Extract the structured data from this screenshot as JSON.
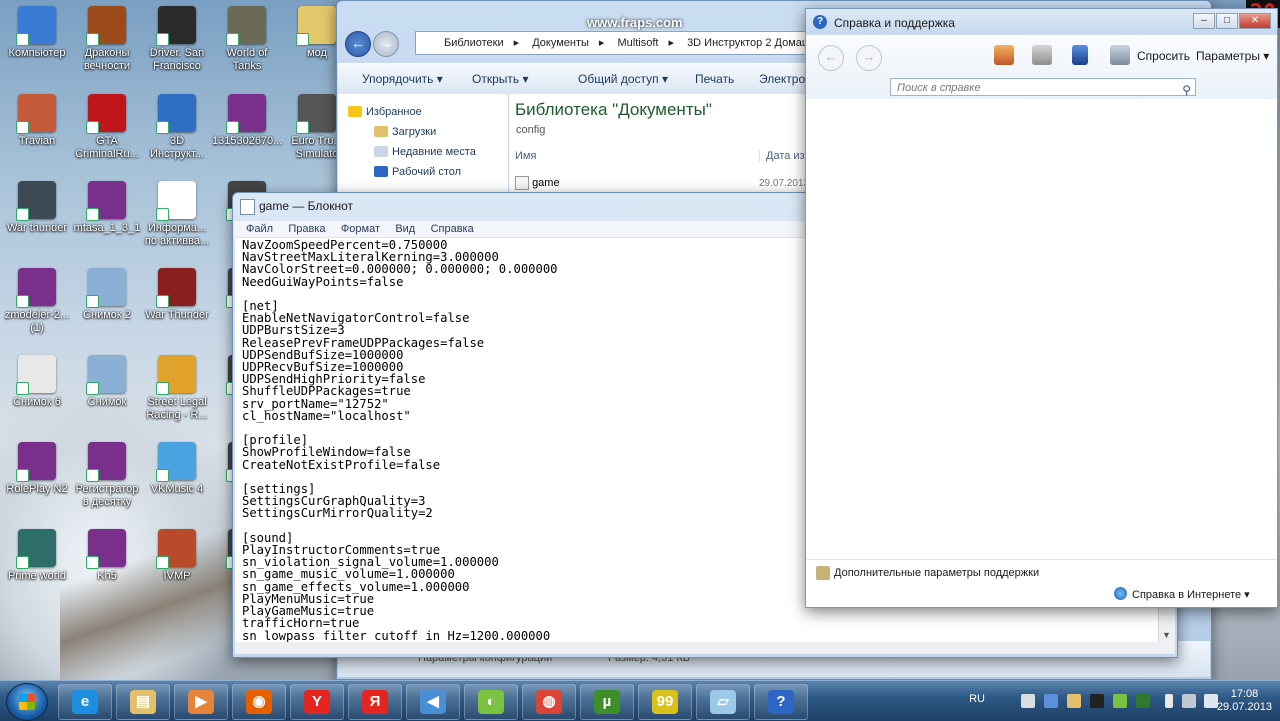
{
  "desktop": {
    "icons": [
      {
        "label": "Компьютер",
        "color": "#3a7bd5"
      },
      {
        "label": "Драконы вечности",
        "color": "#9c4a1a"
      },
      {
        "label": "Driver. San Francisco",
        "color": "#2b2b2b"
      },
      {
        "label": "World of Tanks",
        "color": "#6b6b55"
      },
      {
        "label": "мод",
        "color": "#e5c76b"
      },
      {
        "label": "Travian",
        "color": "#c45a3a"
      },
      {
        "label": "GTA CriminalRu...",
        "color": "#c0161b"
      },
      {
        "label": "3D Инструкт...",
        "color": "#2f6fc2"
      },
      {
        "label": "1315302670...",
        "color": "#7a2f8c"
      },
      {
        "label": "Euro Tru... Simulato",
        "color": "#555555"
      },
      {
        "label": "War thunder",
        "color": "#3d4a55"
      },
      {
        "label": "mtasa_1_3_1",
        "color": "#7a2f8c"
      },
      {
        "label": "Информа... по активва...",
        "color": "#ffffff"
      },
      {
        "label": "La",
        "color": "#444444"
      },
      {
        "label": "zmodeler-2... (1)",
        "color": "#7a2f8c"
      },
      {
        "label": "Снимок 2",
        "color": "#8ab0d6"
      },
      {
        "label": "War Thunder",
        "color": "#8a1f1f"
      },
      {
        "label": "B",
        "color": "#444444"
      },
      {
        "label": "Снимок 6",
        "color": "#e8e8e8"
      },
      {
        "label": "Снимок",
        "color": "#8ab0d6"
      },
      {
        "label": "Street Legal Racing - R...",
        "color": "#e0a22a"
      },
      {
        "label": "K",
        "color": "#444444"
      },
      {
        "label": "RolePlay N2",
        "color": "#7a2f8c"
      },
      {
        "label": "Регистратор в десятку",
        "color": "#7a2f8c"
      },
      {
        "label": "VKMusic 4",
        "color": "#4aa3e0"
      },
      {
        "label": "LIC",
        "color": "#444444"
      },
      {
        "label": "Prime world",
        "color": "#2d6d6a"
      },
      {
        "label": "Kh5",
        "color": "#7a2f8c"
      },
      {
        "label": "IVMP",
        "color": "#b94a2a"
      },
      {
        "label": "R Pa",
        "color": "#444444"
      }
    ],
    "fraps_counter": "20",
    "watermark": "www.fraps.com"
  },
  "explorer": {
    "address": [
      "Библиотеки",
      "Документы",
      "Multisoft",
      "3D Инструктор 2 Домаш"
    ],
    "toolbar": [
      "Упорядочить ▾",
      "Открыть ▾",
      "Общий доступ ▾",
      "Печать",
      "Электрон"
    ],
    "sidebar": [
      "Избранное",
      "Загрузки",
      "Недавние места",
      "Рабочий стол"
    ],
    "library_title": "Библиотека \"Документы\"",
    "library_sub": "config",
    "columns": {
      "name": "Имя",
      "date": "Дата изм"
    },
    "row": {
      "name": "game",
      "date": "29.07.2013"
    },
    "status_left": "Параметры конфигурации",
    "status_right": "Размер: 4,31 КБ"
  },
  "notepad": {
    "title": "game — Блокнот",
    "menu": [
      "Файл",
      "Правка",
      "Формат",
      "Вид",
      "Справка"
    ],
    "content": "NavZoomSpeedPercent=0.750000\nNavStreetMaxLiteralKerning=3.000000\nNavColorStreet=0.000000; 0.000000; 0.000000\nNeedGuiWayPoints=false\n\n[net]\nEnableNetNavigatorControl=false\nUDPBurstSize=3\nReleasePrevFrameUDPPackages=false\nUDPSendBufSize=1000000\nUDPRecvBufSize=1000000\nUDPSendHighPriority=false\nShuffleUDPPackages=true\nsrv_portName=\"12752\"\ncl_hostName=\"localhost\"\n\n[profile]\nShowProfileWindow=false\nCreateNotExistProfile=false\n\n[settings]\nSettingsCurGraphQuality=3\nSettingsCurMirrorQuality=2\n\n[sound]\nPlayInstructorComments=true\nsn_violation_signal_volume=1.000000\nsn_game_music_volume=1.000000\nsn_game_effects_volume=1.000000\nPlayMenuMusic=true\nPlayGameMusic=true\ntrafficHorn=true\nsn_lowpass_filter_cutoff_in_Hz=1200.000000"
  },
  "help": {
    "title": "Справка и поддержка",
    "ask": "Спросить",
    "params": "Параметры ▾",
    "search_placeholder": "Поиск в справке",
    "more_support": "Дополнительные параметры поддержки",
    "online": "Справка в Интернете ▾"
  },
  "taskbar": {
    "lang": "RU",
    "time": "17:08",
    "date": "29.07.2013",
    "apps": [
      {
        "name": "ie",
        "glyph": "e",
        "color": "#1e8fe0"
      },
      {
        "name": "explorer",
        "glyph": "▤",
        "color": "#e3c16b"
      },
      {
        "name": "media-player",
        "glyph": "▶",
        "color": "#e8833a"
      },
      {
        "name": "firefox",
        "glyph": "◉",
        "color": "#e66000"
      },
      {
        "name": "yandex-browser",
        "glyph": "Y",
        "color": "#e52620"
      },
      {
        "name": "yandex",
        "glyph": "Я",
        "color": "#e52620"
      },
      {
        "name": "speaker",
        "glyph": "◀",
        "color": "#4a8fd6"
      },
      {
        "name": "green-app",
        "glyph": "◐",
        "color": "#7cc242"
      },
      {
        "name": "chrome",
        "glyph": "◍",
        "color": "#db4437"
      },
      {
        "name": "utorrent",
        "glyph": "µ",
        "color": "#3e8f2a"
      },
      {
        "name": "fraps",
        "glyph": "99",
        "color": "#d8c21a"
      },
      {
        "name": "notepad",
        "glyph": "▱",
        "color": "#9cc9e8"
      },
      {
        "name": "help",
        "glyph": "?",
        "color": "#2d66c5"
      }
    ]
  }
}
